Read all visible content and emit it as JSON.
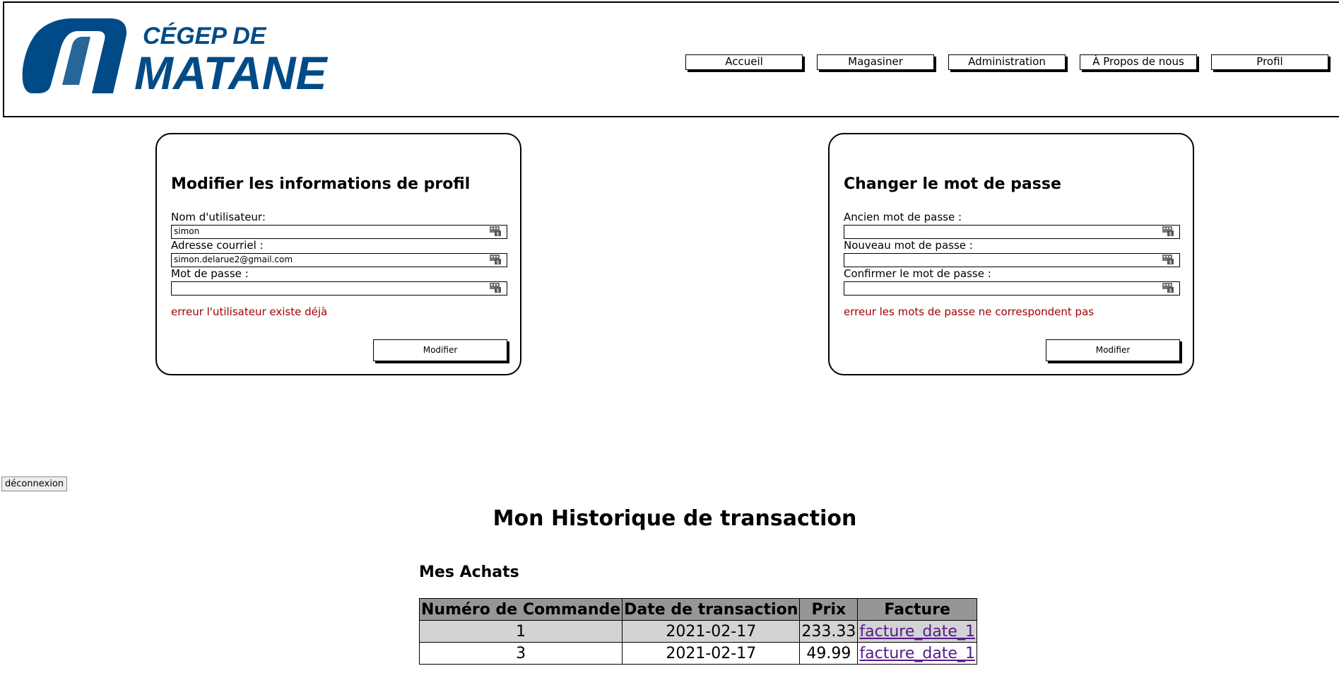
{
  "header": {
    "logo": {
      "line1": "CÉGEP DE",
      "line2": "MATANE",
      "color": "#004b87"
    },
    "nav": [
      {
        "label": "Accueil"
      },
      {
        "label": "Magasiner"
      },
      {
        "label": "Administration"
      },
      {
        "label": "À Propos de nous"
      },
      {
        "label": "Profil"
      }
    ]
  },
  "profile_card": {
    "title": "Modifier les informations de profil",
    "fields": [
      {
        "label": "Nom d'utilisateur:",
        "value": "simon"
      },
      {
        "label": "Adresse courriel :",
        "value": "simon.delarue2@gmail.com"
      },
      {
        "label": "Mot de passe :",
        "value": ""
      }
    ],
    "error": "erreur l'utilisateur existe déjà",
    "submit_label": "Modifier"
  },
  "password_card": {
    "title": "Changer le mot de passe",
    "fields": [
      {
        "label": "Ancien mot de passe :",
        "value": ""
      },
      {
        "label": "Nouveau mot de passe :",
        "value": ""
      },
      {
        "label": "Confirmer le mot de passe :",
        "value": ""
      }
    ],
    "error": "erreur les mots de passe ne correspondent pas",
    "submit_label": "Modifier"
  },
  "logout_label": "déconnexion",
  "history": {
    "title": "Mon Historique de transaction",
    "purchases_title": "Mes Achats",
    "columns": [
      "Numéro de Commande",
      "Date de transaction",
      "Prix",
      "Facture"
    ],
    "rows": [
      {
        "order": "1",
        "date": "2021-02-17",
        "price": "233.33",
        "invoice": "facture_date_1"
      },
      {
        "order": "3",
        "date": "2021-02-17",
        "price": "49.99",
        "invoice": "facture_date_1"
      }
    ]
  },
  "colors": {
    "error": "#a00000",
    "table_header": "#969696",
    "row_highlight": "#d3d3d3",
    "link": "#551a8b"
  }
}
